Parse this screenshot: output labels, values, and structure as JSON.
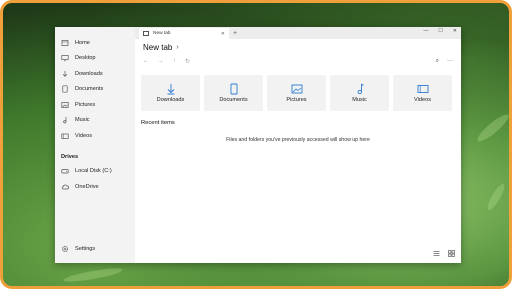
{
  "sidebar": {
    "items": [
      {
        "label": "Home",
        "icon": "home-icon"
      },
      {
        "label": "Desktop",
        "icon": "desktop-icon"
      },
      {
        "label": "Downloads",
        "icon": "download-icon"
      },
      {
        "label": "Documents",
        "icon": "document-icon"
      },
      {
        "label": "Pictures",
        "icon": "picture-icon"
      },
      {
        "label": "Music",
        "icon": "music-icon"
      },
      {
        "label": "Videos",
        "icon": "video-icon"
      }
    ],
    "drives_heading": "Drives",
    "drives": [
      {
        "label": "Local Disk (C:)",
        "icon": "drive-icon"
      },
      {
        "label": "OneDrive",
        "icon": "cloud-icon"
      }
    ],
    "settings_label": "Settings"
  },
  "tabbar": {
    "tab_title": "New tab",
    "close_glyph": "✕",
    "new_tab_glyph": "+",
    "window_controls": [
      "—",
      "☐",
      "✕"
    ]
  },
  "header": {
    "title": "New tab",
    "chevron": "›"
  },
  "nav": {
    "back": "←",
    "forward": "→",
    "up": "↑",
    "refresh": "↻",
    "search": "⌕",
    "more": "···"
  },
  "tiles": [
    {
      "label": "Downloads",
      "icon": "download-icon"
    },
    {
      "label": "Documents",
      "icon": "document-icon"
    },
    {
      "label": "Pictures",
      "icon": "picture-icon"
    },
    {
      "label": "Music",
      "icon": "music-icon"
    },
    {
      "label": "Videos",
      "icon": "video-icon"
    }
  ],
  "recent": {
    "heading": "Recent items",
    "empty_message": "Files and folders you've previously accessed will show up here"
  },
  "colors": {
    "accent": "#2b79d0",
    "frame_border": "#f0a03a"
  }
}
